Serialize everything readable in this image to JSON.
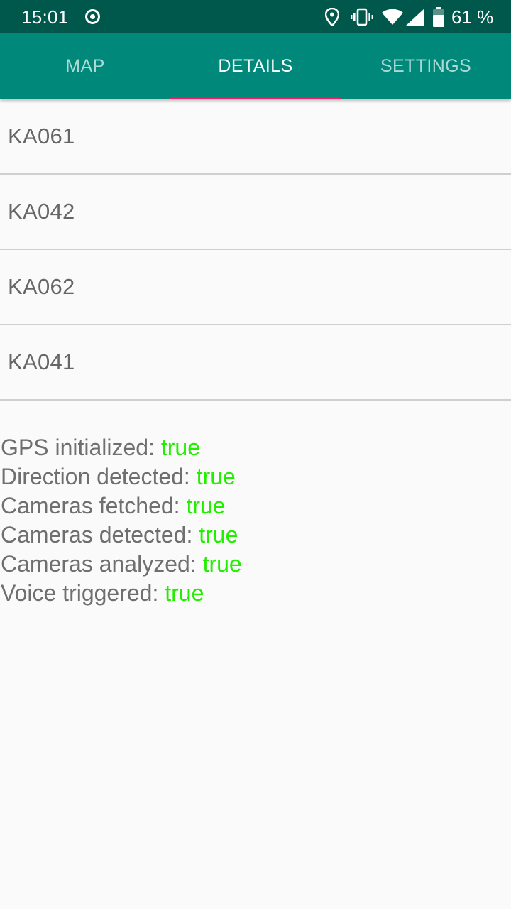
{
  "status_bar": {
    "time": "15:01",
    "battery_percent": "61 %",
    "icons": [
      "sync-icon",
      "location-icon",
      "vibrate-icon",
      "wifi-icon",
      "signal-icon",
      "battery-icon"
    ]
  },
  "tabs": [
    {
      "label": "MAP",
      "active": false
    },
    {
      "label": "DETAILS",
      "active": true
    },
    {
      "label": "SETTINGS",
      "active": false
    }
  ],
  "colors": {
    "status_bar": "#00574b",
    "toolbar": "#00887a",
    "indicator": "#e91e63",
    "value_true": "#22ee00"
  },
  "cameras": [
    "KA061",
    "KA042",
    "KA062",
    "KA041"
  ],
  "status": [
    {
      "label": "GPS initialized: ",
      "value": "true"
    },
    {
      "label": "Direction detected: ",
      "value": "true"
    },
    {
      "label": "Cameras fetched: ",
      "value": "true"
    },
    {
      "label": "Cameras detected: ",
      "value": "true"
    },
    {
      "label": "Cameras analyzed: ",
      "value": "true"
    },
    {
      "label": "Voice triggered: ",
      "value": "true"
    }
  ]
}
